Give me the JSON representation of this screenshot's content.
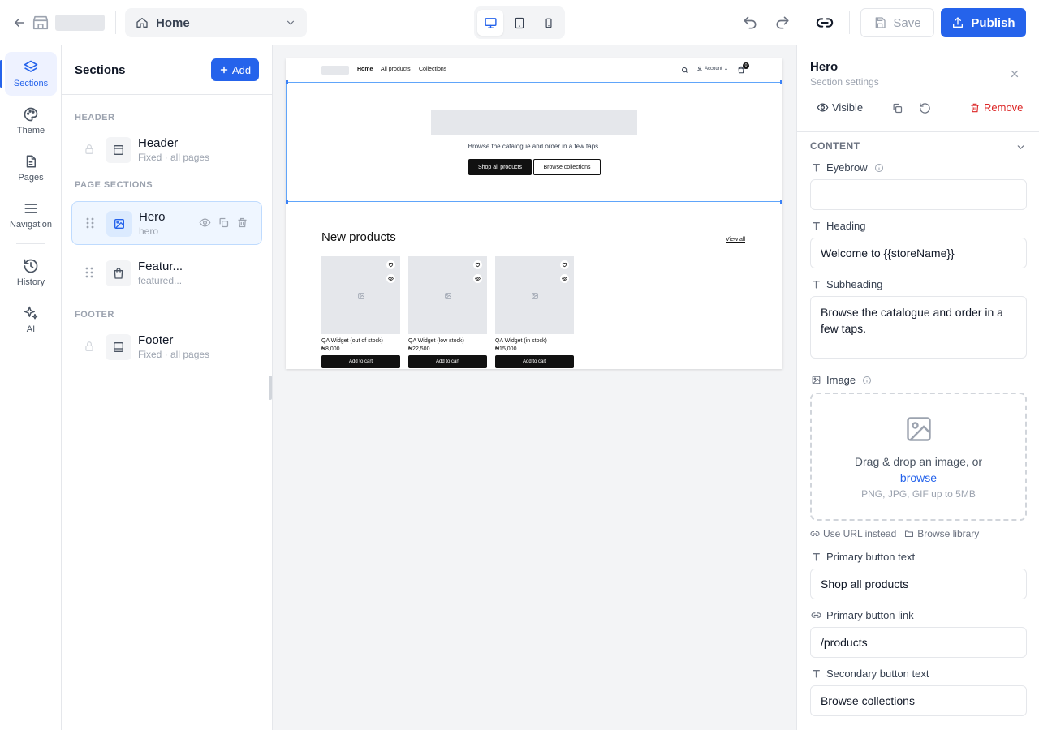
{
  "topbar": {
    "page_selector": "Home",
    "save_label": "Save",
    "publish_label": "Publish",
    "icons": [
      "back-arrow-icon",
      "store-icon",
      "home-icon",
      "chevron-down-icon",
      "desktop-icon",
      "tablet-icon",
      "mobile-icon",
      "undo-icon",
      "redo-icon",
      "link-icon",
      "save-icon",
      "upload-icon"
    ]
  },
  "rail": {
    "items": [
      {
        "label": "Sections",
        "icon": "layers-icon",
        "active": true
      },
      {
        "label": "Theme",
        "icon": "palette-icon"
      },
      {
        "label": "Pages",
        "icon": "file-icon"
      },
      {
        "label": "Navigation",
        "icon": "menu-icon"
      },
      {
        "label": "History",
        "icon": "history-icon"
      },
      {
        "label": "AI",
        "icon": "sparkles-icon"
      }
    ]
  },
  "sections_panel": {
    "title": "Sections",
    "add_label": "Add",
    "groups": {
      "header": "HEADER",
      "page_sections": "PAGE SECTIONS",
      "footer": "FOOTER"
    },
    "header_item": {
      "name": "Header",
      "sub": "Fixed · all pages"
    },
    "page_items": [
      {
        "name": "Hero",
        "sub": "hero",
        "selected": true
      },
      {
        "name": "Featur...",
        "sub": "featured..."
      }
    ],
    "footer_item": {
      "name": "Footer",
      "sub": "Fixed · all pages"
    }
  },
  "preview": {
    "nav": {
      "links": [
        "Home",
        "All products",
        "Collections"
      ],
      "account": "Account",
      "cart_count": "0"
    },
    "hero": {
      "subheading": "Browse the catalogue and order in a few taps.",
      "primary_button": "Shop all products",
      "secondary_button": "Browse collections"
    },
    "new_products": {
      "title": "New products",
      "view_all": "View all",
      "products": [
        {
          "name": "QA Widget (out of stock)",
          "price": "₦8,000",
          "cta": "Add to cart"
        },
        {
          "name": "QA Widget (low stock)",
          "price": "₦22,500",
          "cta": "Add to cart"
        },
        {
          "name": "QA Widget (in stock)",
          "price": "₦15,000",
          "cta": "Add to cart"
        }
      ]
    }
  },
  "settings": {
    "title": "Hero",
    "subtitle": "Section settings",
    "visible_label": "Visible",
    "remove_label": "Remove",
    "group_label": "CONTENT",
    "fields": {
      "eyebrow": {
        "label": "Eyebrow",
        "value": ""
      },
      "heading": {
        "label": "Heading",
        "value": "Welcome to {{storeName}}"
      },
      "subheading": {
        "label": "Subheading",
        "value": "Browse the catalogue and order in a few taps."
      },
      "image": {
        "label": "Image"
      },
      "primary_text": {
        "label": "Primary button text",
        "value": "Shop all products"
      },
      "primary_link": {
        "label": "Primary button link",
        "value": "/products"
      },
      "secondary_text": {
        "label": "Secondary button text",
        "value": "Browse collections"
      }
    },
    "dropzone": {
      "text": "Drag & drop an image, or",
      "browse": "browse",
      "hint": "PNG, JPG, GIF up to 5MB"
    },
    "image_links": {
      "url": "Use URL instead",
      "library": "Browse library"
    }
  }
}
